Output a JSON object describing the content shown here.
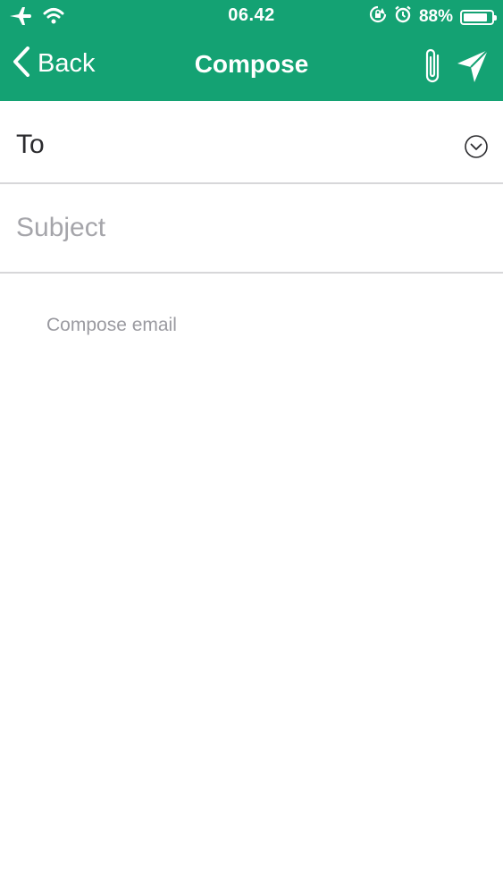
{
  "status_bar": {
    "time": "06.42",
    "battery_text": "88%",
    "battery_level": 0.88,
    "icons": [
      "airplane-icon",
      "wifi-icon",
      "rotation-lock-icon",
      "alarm-icon",
      "battery-icon"
    ]
  },
  "nav": {
    "back_label": "Back",
    "title": "Compose",
    "attach_icon": "paperclip-icon",
    "send_icon": "send-icon"
  },
  "compose": {
    "to_label": "To",
    "to_expand_icon": "chevron-down-circle-icon",
    "subject_value": "",
    "subject_placeholder": "Subject",
    "body_value": "",
    "body_placeholder": "Compose email"
  },
  "colors": {
    "header_bg": "#14a273",
    "divider": "#d7d7d9",
    "placeholder": "#a5a5aa"
  }
}
